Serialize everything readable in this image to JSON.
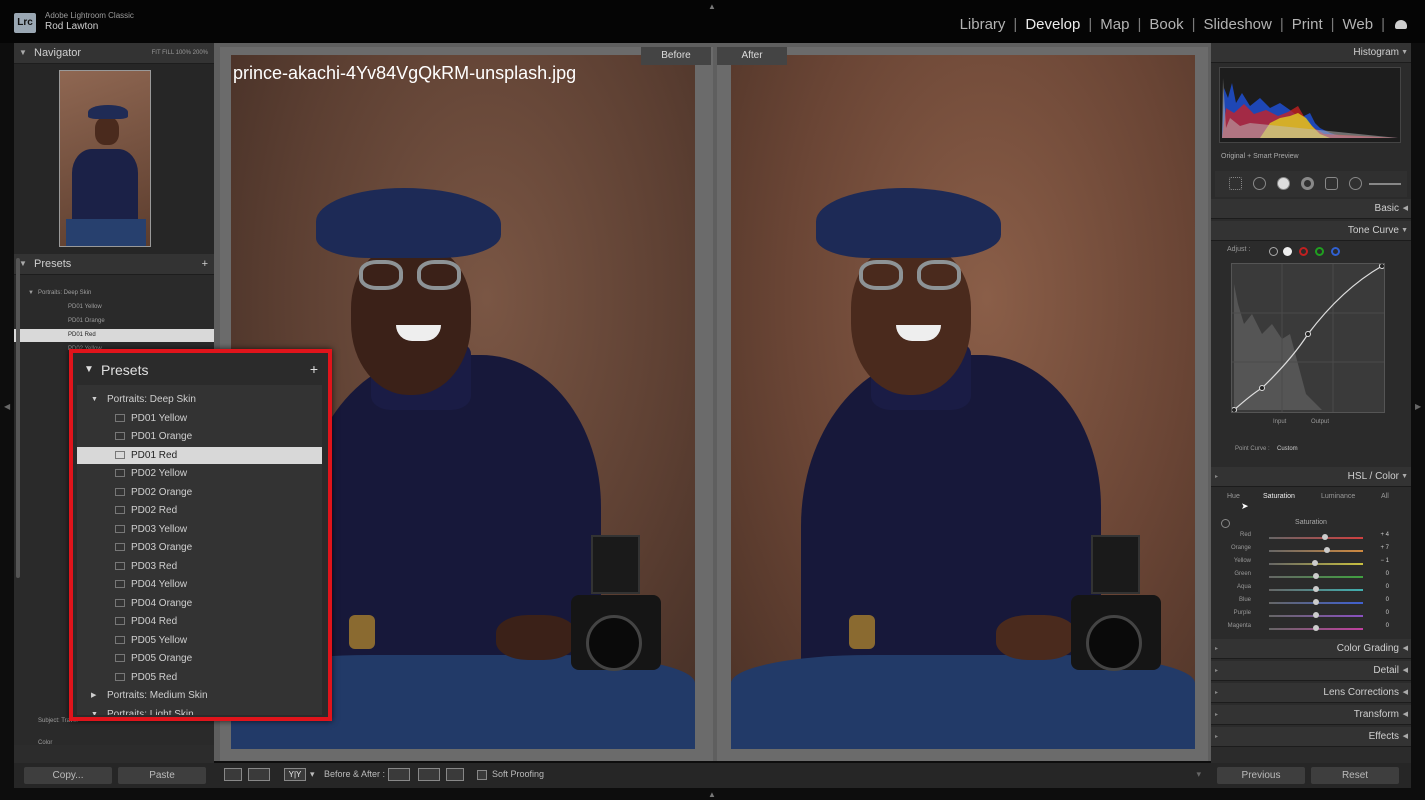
{
  "app": {
    "logo": "Lrc",
    "name": "Adobe Lightroom Classic",
    "user": "Rod Lawton"
  },
  "modules": [
    "Library",
    "Develop",
    "Map",
    "Book",
    "Slideshow",
    "Print",
    "Web"
  ],
  "active_module": "Develop",
  "left_panel": {
    "navigator_title": "Navigator",
    "navigator_zoom": "FIT  FILL  100%  200%",
    "presets_title": "Presets",
    "presets_add": "+",
    "small_rows": [
      {
        "label": "Portraits: Deep Skin",
        "type": "group",
        "selected": false
      },
      {
        "label": "PD01 Yellow",
        "type": "preset",
        "selected": false
      },
      {
        "label": "PD01 Orange",
        "type": "preset",
        "selected": false
      },
      {
        "label": "PD01 Red",
        "type": "preset",
        "selected": true
      },
      {
        "label": "PD02 Yellow",
        "type": "preset",
        "selected": false
      }
    ],
    "small_rows_bottom": [
      {
        "label": "Subject: Travel",
        "type": "group"
      },
      {
        "label": "Color",
        "type": "group"
      }
    ],
    "copy_button": "Copy...",
    "paste_button": "Paste"
  },
  "popup": {
    "title": "Presets",
    "add": "+",
    "rows": [
      {
        "label": "Portraits: Deep Skin",
        "type": "group-open",
        "selected": false
      },
      {
        "label": "PD01 Yellow",
        "type": "preset",
        "selected": false
      },
      {
        "label": "PD01 Orange",
        "type": "preset",
        "selected": false
      },
      {
        "label": "PD01 Red",
        "type": "preset",
        "selected": true
      },
      {
        "label": "PD02 Yellow",
        "type": "preset",
        "selected": false
      },
      {
        "label": "PD02 Orange",
        "type": "preset",
        "selected": false
      },
      {
        "label": "PD02 Red",
        "type": "preset",
        "selected": false
      },
      {
        "label": "PD03 Yellow",
        "type": "preset",
        "selected": false
      },
      {
        "label": "PD03 Orange",
        "type": "preset",
        "selected": false
      },
      {
        "label": "PD03 Red",
        "type": "preset",
        "selected": false
      },
      {
        "label": "PD04 Yellow",
        "type": "preset",
        "selected": false
      },
      {
        "label": "PD04 Orange",
        "type": "preset",
        "selected": false
      },
      {
        "label": "PD04 Red",
        "type": "preset",
        "selected": false
      },
      {
        "label": "PD05 Yellow",
        "type": "preset",
        "selected": false
      },
      {
        "label": "PD05 Orange",
        "type": "preset",
        "selected": false
      },
      {
        "label": "PD05 Red",
        "type": "preset",
        "selected": false
      },
      {
        "label": "Portraits: Medium Skin",
        "type": "group-closed",
        "selected": false
      },
      {
        "label": "Portraits: Light Skin",
        "type": "group-open",
        "selected": false
      }
    ],
    "border_color": "#e0141b"
  },
  "viewer": {
    "filename": "prince-akachi-4Yv84VgQkRM-unsplash.jpg",
    "before_label": "Before",
    "after_label": "After"
  },
  "toolbar": {
    "before_after_label": "Before & After :",
    "view_mode": "Y|Y",
    "soft_proofing": "Soft Proofing"
  },
  "right_panel": {
    "histogram_title": "Histogram",
    "histogram_info": "Original + Smart Preview",
    "basic_title": "Basic",
    "tone_curve_title": "Tone Curve",
    "tone_adjust": "Adjust :",
    "tone_input": "Input",
    "tone_output": "Output",
    "point_curve_label": "Point Curve :",
    "point_curve_value": "Custom",
    "hsl_title": "HSL / Color",
    "hsl_tabs": [
      "Hue",
      "Saturation",
      "Luminance",
      "All"
    ],
    "hsl_active_tab": "Saturation",
    "hsl_section": "Saturation",
    "hsl_rows": [
      {
        "name": "Red",
        "value": "+ 4",
        "color": "#d04040"
      },
      {
        "name": "Orange",
        "value": "+ 7",
        "color": "#d08a40"
      },
      {
        "name": "Yellow",
        "value": "− 1",
        "color": "#c9c040"
      },
      {
        "name": "Green",
        "value": "0",
        "color": "#40a040"
      },
      {
        "name": "Aqua",
        "value": "0",
        "color": "#40b0b0"
      },
      {
        "name": "Blue",
        "value": "0",
        "color": "#4060d0"
      },
      {
        "name": "Purple",
        "value": "0",
        "color": "#8a50c0"
      },
      {
        "name": "Magenta",
        "value": "0",
        "color": "#c040a0"
      }
    ],
    "sections": [
      "Color Grading",
      "Detail",
      "Lens Corrections",
      "Transform",
      "Effects"
    ],
    "previous_button": "Previous",
    "reset_button": "Reset"
  }
}
